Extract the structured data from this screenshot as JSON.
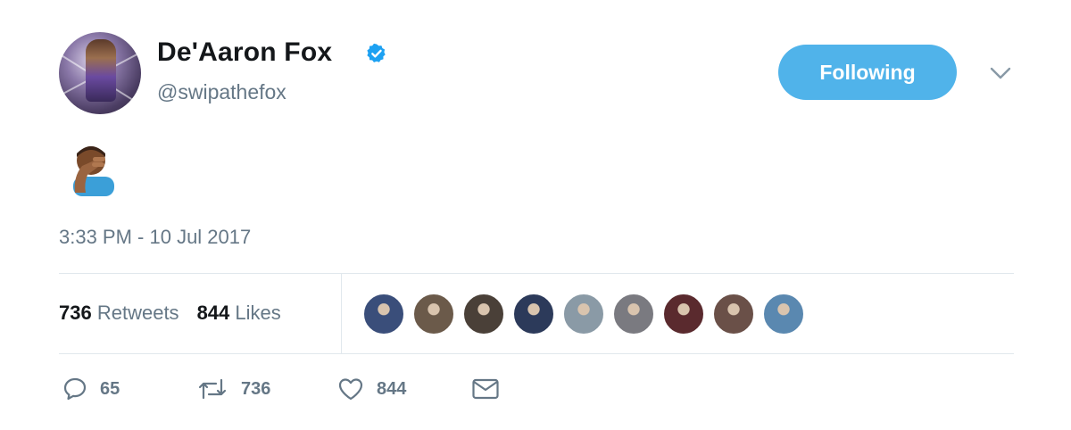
{
  "user": {
    "display_name": "De'Aaron Fox",
    "handle": "@swipathefox",
    "verified": true
  },
  "follow_button": {
    "label": "Following"
  },
  "tweet": {
    "content_emoji": "person-facepalming-medium-dark-skin",
    "timestamp": "3:33 PM - 10 Jul 2017"
  },
  "stats": {
    "retweets_count": "736",
    "retweets_label": "Retweets",
    "likes_count": "844",
    "likes_label": "Likes"
  },
  "likers": [
    {
      "color": "#3a4e7a"
    },
    {
      "color": "#6b5a4a"
    },
    {
      "color": "#4a4038"
    },
    {
      "color": "#2c3a5a"
    },
    {
      "color": "#8a9aa6"
    },
    {
      "color": "#7a7a80"
    },
    {
      "color": "#5a2a2e"
    },
    {
      "color": "#6a5048"
    },
    {
      "color": "#5a88b0"
    }
  ],
  "actions": {
    "reply_count": "65",
    "retweet_count": "736",
    "like_count": "844"
  },
  "colors": {
    "accent": "#1da1f2",
    "button": "#50b3ea",
    "secondary_text": "#657786",
    "divider": "#e1e8ed"
  }
}
